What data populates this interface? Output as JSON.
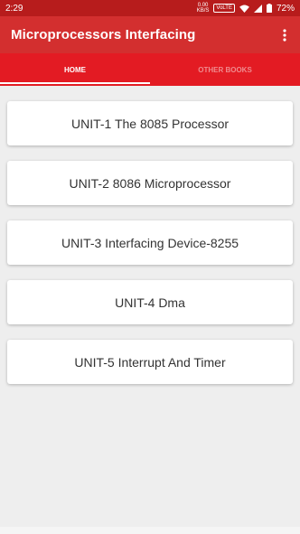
{
  "status_bar": {
    "time": "2:29",
    "net_speed_value": "0.00",
    "net_speed_unit": "KB/S",
    "volte": "VoLTE",
    "battery": "72%"
  },
  "app_bar": {
    "title": "Microprocessors Interfacing",
    "overflow_icon": "more-vert-icon"
  },
  "tabs": [
    {
      "label": "HOME",
      "selected": true
    },
    {
      "label": "OTHER BOOKS",
      "selected": false
    }
  ],
  "units": [
    {
      "label": "UNIT-1 The 8085 Processor"
    },
    {
      "label": "UNIT-2 8086 Microprocessor"
    },
    {
      "label": "UNIT-3 Interfacing Device-8255"
    },
    {
      "label": "UNIT-4 Dma"
    },
    {
      "label": "UNIT-5 Interrupt And Timer"
    }
  ],
  "colors": {
    "status_bar": "#b71c1c",
    "app_bar": "#d32f2f",
    "tab_bar": "#e31b23",
    "background": "#eeeeee"
  }
}
